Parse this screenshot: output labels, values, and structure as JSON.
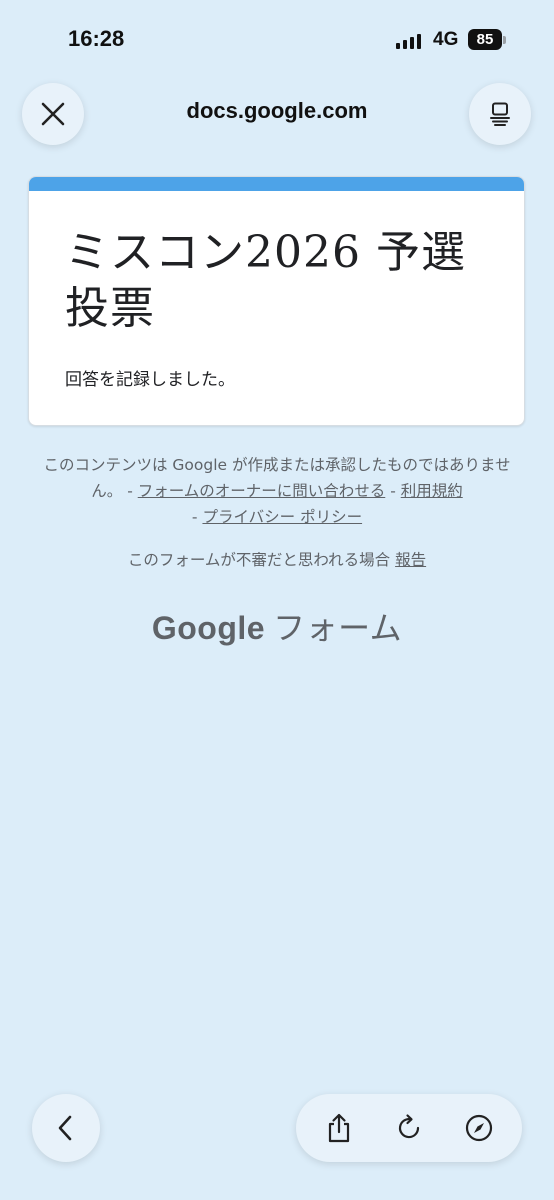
{
  "status_bar": {
    "time": "16:28",
    "network": "4G",
    "battery": "85"
  },
  "browser": {
    "url": "docs.google.com",
    "close_icon": "close-icon",
    "reader_icon": "reader-mode-icon",
    "back_icon": "chevron-left-icon",
    "share_icon": "share-icon",
    "reload_icon": "reload-icon",
    "compass_icon": "compass-icon"
  },
  "form": {
    "accent_color": "#4da3e8",
    "title": "ミスコン2026 予選投票",
    "message": "回答を記録しました。"
  },
  "footer": {
    "disclaimer_text": "このコンテンツは Google が作成または承認したものではありません。 - ",
    "contact_owner_link": "フォームのオーナーに問い合わせる",
    "separator1": " - ",
    "terms_link": "利用規約",
    "separator2": " - ",
    "privacy_link": "プライバシー ポリシー",
    "report_text": "このフォームが不審だと思われる場合 ",
    "report_link": "報告",
    "brand_google": "Google",
    "brand_forms": "フォーム"
  }
}
